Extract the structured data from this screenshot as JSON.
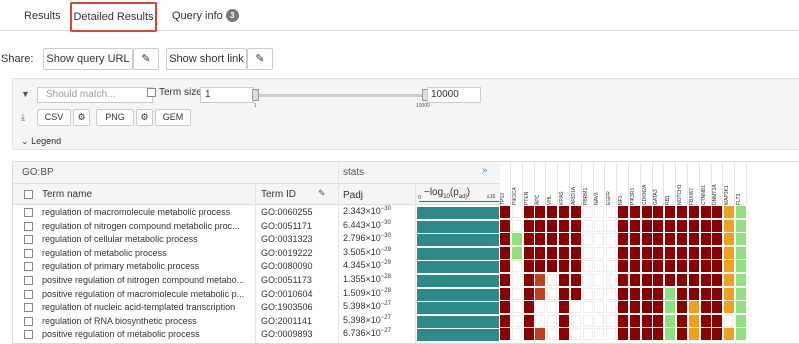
{
  "tabs": [
    {
      "label": "Results"
    },
    {
      "label": "Detailed Results"
    },
    {
      "label": "Query info",
      "badge": "3"
    }
  ],
  "share": {
    "label": "Share:",
    "query_url_button": "Show query URL",
    "short_link_button": "Show short link"
  },
  "filters": {
    "should_match_placeholder": "Should match...",
    "term_size_label": "Term size",
    "term_min": "1",
    "term_max": "10000",
    "slider_min_tick": "1",
    "slider_max_tick": "10000"
  },
  "export": {
    "csv": "CSV",
    "png": "PNG",
    "gem": "GEM"
  },
  "legend_label": "Legend",
  "table": {
    "source": "GO:BP",
    "stats_header": "stats",
    "expand_symbol": "»",
    "columns": {
      "term_name": "Term name",
      "term_id": "Term ID",
      "padj": "Padj",
      "bar_label": "−log₁₀(pₐ⁤dj)",
      "bar_zero": "0",
      "bar_max": "≤16"
    },
    "rows": [
      {
        "term": "regulation of macromolecule metabolic process",
        "id": "GO:0060255",
        "padj_base": "2.343×10",
        "padj_exp": "−30",
        "bar": 1.0
      },
      {
        "term": "regulation of nitrogen compound metabolic proc...",
        "id": "GO:0051171",
        "padj_base": "6.443×10",
        "padj_exp": "−30",
        "bar": 1.0
      },
      {
        "term": "regulation of cellular metabolic process",
        "id": "GO:0031323",
        "padj_base": "2.796×10",
        "padj_exp": "−30",
        "bar": 1.0
      },
      {
        "term": "regulation of metabolic process",
        "id": "GO:0019222",
        "padj_base": "3.505×10",
        "padj_exp": "−29",
        "bar": 1.0
      },
      {
        "term": "regulation of primary metabolic process",
        "id": "GO:0080090",
        "padj_base": "4.345×10",
        "padj_exp": "−29",
        "bar": 1.0
      },
      {
        "term": "positive regulation of nitrogen compound metabo...",
        "id": "GO:0051173",
        "padj_base": "1.355×10",
        "padj_exp": "−28",
        "bar": 1.0
      },
      {
        "term": "positive regulation of macromolecule metabolic p...",
        "id": "GO:0010604",
        "padj_base": "1.509×10",
        "padj_exp": "−28",
        "bar": 1.0
      },
      {
        "term": "regulation of nucleic acid-templated transcription",
        "id": "GO:1903506",
        "padj_base": "5.398×10",
        "padj_exp": "−27",
        "bar": 1.0
      },
      {
        "term": "regulation of RNA biosynthetic process",
        "id": "GO:2001141",
        "padj_base": "5.398×10",
        "padj_exp": "−27",
        "bar": 1.0
      },
      {
        "term": "positive regulation of metabolic process",
        "id": "GO:0009893",
        "padj_base": "6.736×10",
        "padj_exp": "−27",
        "bar": 1.0
      }
    ]
  },
  "genes": [
    "TP53",
    "PIK3CA",
    "PTEN",
    "APC",
    "VHL",
    "KRAS",
    "ARID1A",
    "PBRM1",
    "NAV3",
    "EGFR",
    "NF1",
    "PIK3R1",
    "CDKN2A",
    "GATA3",
    "RB1",
    "NOTCH1",
    "FBXW7",
    "CTNNB1",
    "DNMT3A",
    "MAP3K1",
    "FLT3"
  ],
  "colors": {
    "dark_red": "#8b0000",
    "orange": "#f0a020",
    "green": "#90e080",
    "red": "#c04020",
    "white": "#ffffff",
    "teal": "#2e8b8b",
    "accent_tab_border": "#d9472b"
  },
  "heatmap": [
    "DWDDDDDWWWDDDDDDDDDOG",
    "DWDDDDDWWWDDDDDDDDDOG",
    "DGDDDDDWWWDDDDDDDDDOG",
    "DGDDDDDWWWDDDDDDDDDOG",
    "DWDDDDDWWWDDDDDDDDDOG",
    "DWDRWDDWWWDDDDDDDDDOG",
    "DWDRWDDWWWDDDDGDDDDOG",
    "DWDWWDWWWWDDDDGDODDOG",
    "DWDWWDWWWWDDDDGDODDWG",
    "DWDRWDWWWWDDDDGDODDOG"
  ]
}
